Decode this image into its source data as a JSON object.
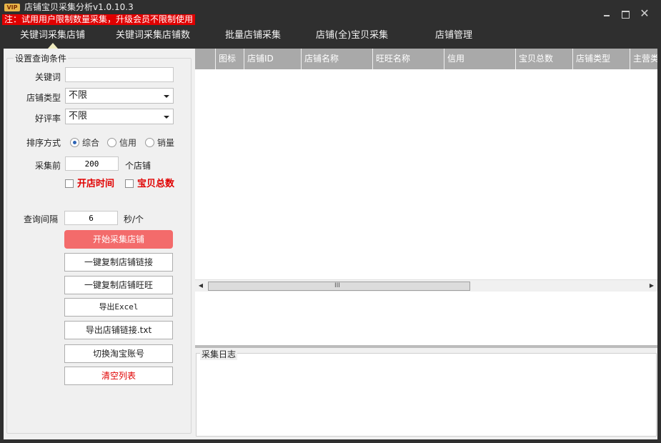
{
  "window": {
    "badge": "VIP",
    "title": "店铺宝贝采集分析v1.0.10.3",
    "notice": "注：试用用户限制数量采集，升级会员不限制使用",
    "controls": {
      "minimize": "",
      "maximize": "",
      "close": "✕"
    }
  },
  "nav": {
    "tabs": [
      {
        "label": "关键词采集店铺",
        "active": true
      },
      {
        "label": "关键词采集店铺数",
        "active": false
      },
      {
        "label": "批量店铺采集",
        "active": false
      },
      {
        "label": "店铺(全)宝贝采集",
        "active": false
      },
      {
        "label": "店铺管理",
        "active": false
      }
    ]
  },
  "query": {
    "group_title": "设置查询条件",
    "keyword": {
      "label": "关键词",
      "value": ""
    },
    "shop_type": {
      "label": "店铺类型",
      "selected": "不限"
    },
    "rating": {
      "label": "好评率",
      "selected": "不限"
    },
    "sort": {
      "label": "排序方式",
      "options": [
        {
          "label": "综合",
          "checked": true
        },
        {
          "label": "信用",
          "checked": false
        },
        {
          "label": "销量",
          "checked": false
        }
      ]
    },
    "collect_count": {
      "label": "采集前",
      "value": "200",
      "unit": "个店铺"
    },
    "extra_fields": [
      {
        "label": "开店时间",
        "checked": false
      },
      {
        "label": "宝贝总数",
        "checked": false
      }
    ],
    "interval": {
      "label": "查询间隔",
      "value": "6",
      "unit": "秒/个"
    }
  },
  "actions": {
    "start": "开始采集店铺",
    "copy_links": "一键复制店铺链接",
    "copy_wangwang": "一键复制店铺旺旺",
    "export_excel": "导出Excel",
    "export_txt": "导出店铺链接.txt",
    "switch_account": "切换淘宝账号",
    "clear_list": "清空列表"
  },
  "grid": {
    "columns": [
      "",
      "图标",
      "店铺ID",
      "店铺名称",
      "旺旺名称",
      "信用",
      "宝贝总数",
      "店铺类型",
      "主营类"
    ],
    "rows": [],
    "scroll_grip": "III"
  },
  "log": {
    "title": "采集日志",
    "lines": []
  }
}
